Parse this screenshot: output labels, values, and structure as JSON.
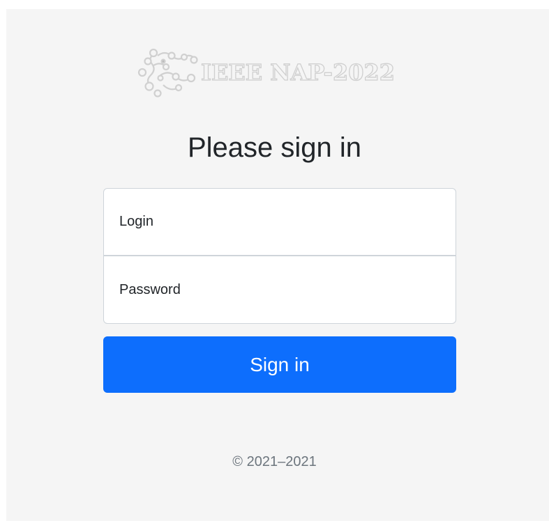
{
  "logo": {
    "text": "IEEE NAP-2022",
    "icon": "molecule-network-logo"
  },
  "form": {
    "title": "Please sign in",
    "login_placeholder": "Login",
    "password_placeholder": "Password",
    "submit_label": "Sign in"
  },
  "footer": {
    "copyright": "© 2021–2021"
  },
  "colors": {
    "primary": "#0d6efd",
    "panel_background": "#f5f5f5",
    "text": "#212529",
    "muted": "#6c757d"
  }
}
